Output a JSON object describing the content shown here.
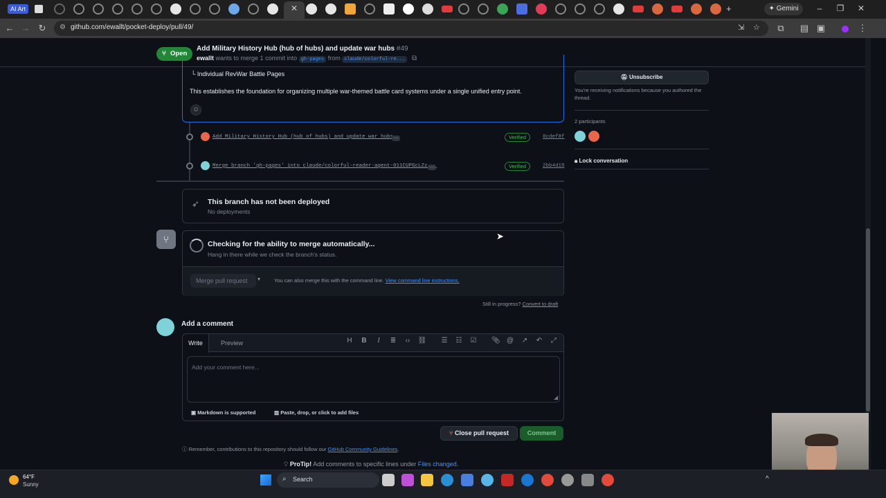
{
  "browser": {
    "ai_chip": "AI Art",
    "gemini_label": "Gemini",
    "url": "github.com/ewallt/pocket-deploy/pull/49/"
  },
  "pr_header": {
    "state": "Open",
    "title": "Add Military History Hub (hub of hubs) and update war hubs",
    "number": "#49",
    "author": "ewallt",
    "merge_text": "wants to merge 1 commit into",
    "base_branch": "gh-pages",
    "from_text": "from",
    "head_branch": "claude/colorful-re..."
  },
  "description": {
    "tree_line": "└ Individual RevWar Battle Pages",
    "body": "This establishes the foundation for organizing multiple war-themed battle card systems under a single unified entry point."
  },
  "commits": [
    {
      "message": "Add Military History Hub (hub of hubs) and update war hubs",
      "badge": "Verified",
      "sha": "8cdef8f"
    },
    {
      "message": "Merge branch 'gh-pages' into claude/colorful-reader-agent-011CUPGcLZz...",
      "badge": "Verified",
      "sha": "2bb4d19"
    }
  ],
  "deployment": {
    "title": "This branch has not been deployed",
    "subtitle": "No deployments"
  },
  "merge_box": {
    "title": "Checking for the ability to merge automatically...",
    "subtitle": "Hang in there while we check the branch's status.",
    "merge_button": "Merge pull request",
    "cli_text": "You can also merge this with the command line.",
    "cli_link": "View command line instructions.",
    "still_text": "Still in progress?",
    "draft_link": "Convert to draft"
  },
  "comment": {
    "heading": "Add a comment",
    "tab_write": "Write",
    "tab_preview": "Preview",
    "placeholder": "Add your comment here...",
    "markdown_note": "Markdown is supported",
    "files_note": "Paste, drop, or click to add files",
    "close_button": "Close pull request",
    "comment_button": "Comment",
    "guidelines_text": "Remember, contributions to this repository should follow our",
    "guidelines_link": "GitHub Community Guidelines",
    "protip_label": "ProTip!",
    "protip_text": "Add comments to specific lines under",
    "protip_link": "Files changed"
  },
  "sidebar": {
    "unsubscribe": "Unsubscribe",
    "notify_text": "You're receiving notifications because you authored the thread.",
    "participants": "2 participants",
    "lock": "Lock conversation"
  },
  "taskbar": {
    "temperature": "64°F",
    "weather": "Sunny",
    "search": "Search"
  },
  "colors": {
    "accent_green": "#238636",
    "link_blue": "#4493f8",
    "page_bg": "#0d1117"
  }
}
